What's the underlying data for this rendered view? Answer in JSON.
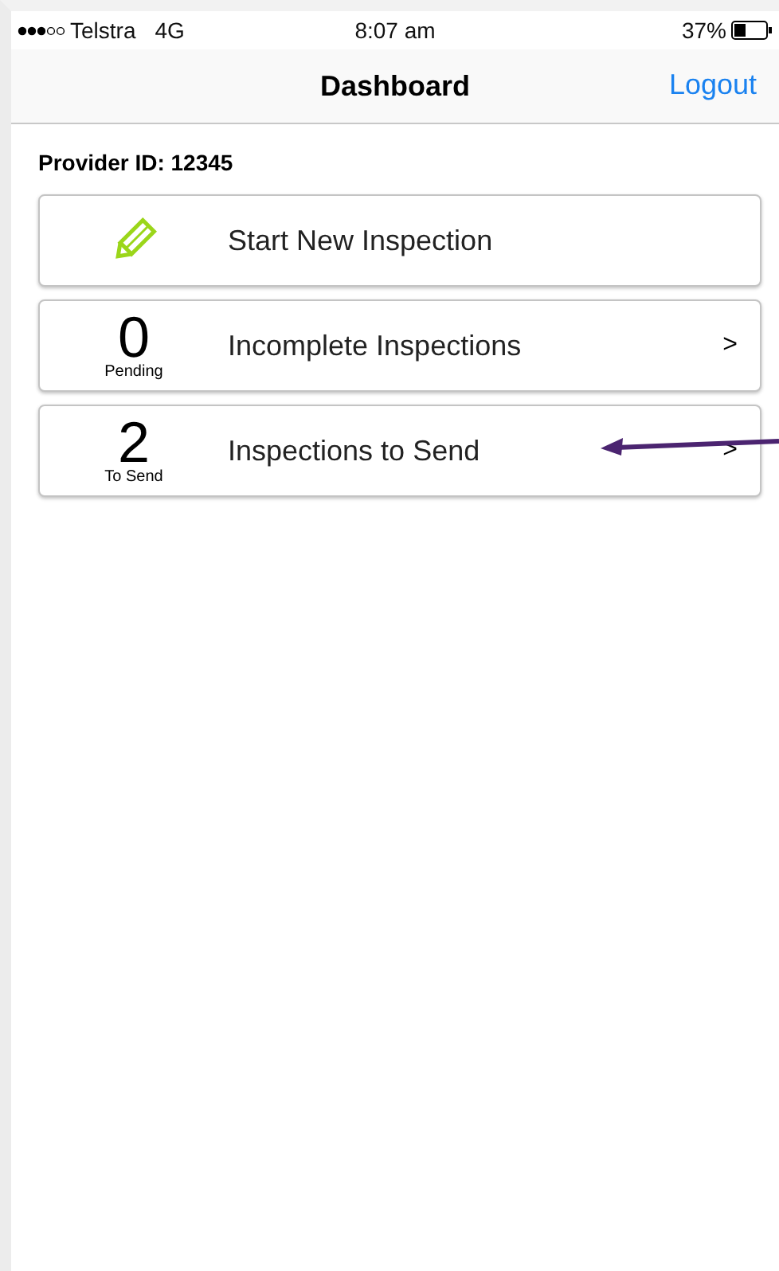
{
  "status_bar": {
    "carrier": "Telstra",
    "network": "4G",
    "time": "8:07 am",
    "battery": "37%"
  },
  "nav_bar": {
    "title": "Dashboard",
    "action": "Logout"
  },
  "provider_id": "Provider ID: 12345",
  "items": [
    {
      "kind": "action",
      "label": "Start New Inspection"
    },
    {
      "kind": "counter",
      "count": "0",
      "caption": "Pending",
      "label": "Incomplete Inspections",
      "chevron": ">"
    },
    {
      "kind": "counter",
      "count": "2",
      "caption": "To Send",
      "label": "Inspections to Send",
      "chevron": ">"
    }
  ]
}
